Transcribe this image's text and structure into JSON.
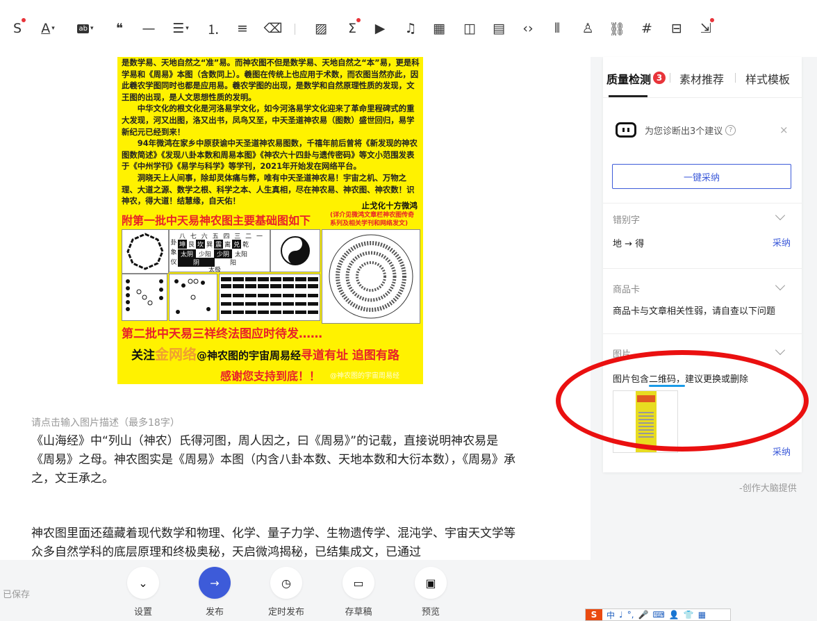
{
  "toolbar": {
    "icons": [
      "strikethrough-icon",
      "font-color-icon",
      "highlight-icon",
      "quote-icon",
      "divider-icon",
      "align-icon",
      "ordered-list-icon",
      "unordered-list-icon",
      "eraser-icon",
      "image-icon",
      "formula-icon",
      "video-icon",
      "audio-icon",
      "table-icon",
      "vote-icon",
      "save-icon",
      "code-icon",
      "chart-icon",
      "person-icon",
      "link-icon",
      "hashtag-icon",
      "bookmark-icon",
      "import-icon"
    ]
  },
  "poster": {
    "text": "是数学易、天地自然之“准”易。而神农图不但是数学易、天地自然之“本”易，更是科学易和《周易》本图（含数同上）。羲图在传统上也应用于术数，而农图当然亦此，因此羲农学图同时也都是应用易。羲农学图的出现，是数学和自然原理性质的发现，文王图的出现，是人文思想性质的发明。\n　　中华文化的根文化是河洛易学文化，如今河洛易学文化迎来了革命里程碑式的重大发现，河又出图，洛又出书，凤鸟又至，中天圣道神农易（图数）盛世回归，易学新纪元已经到来！\n　　94年微鸿在家乡中原获谕中天圣道神农易图数，千禧年前后曾将《新发现的神农图数简述》《发现八卦本数和周易本图》《神农六十四卦与遗传密码》等文小范围发表于《中州学刊》《易学与科学》等学刊，2021年开始发在网络平台。\n　　洞晓天上人间事，除却灵体痛与弊，唯有中天圣道神农易！宇宙之机、万物之理、大道之源、数学之根、科学之本、人生真相，尽在神农易、神农图、神农数！识神农，得大道！结慧缘，自天佑！",
    "signature": "止戈化十方微鸿",
    "heading1": "附第一批中天易神农图主要基础图如下",
    "heading1_note": "(详介见微鸿文章栏神农图传奇系列及相关学刊和网络发文)",
    "heading2": "第二批中天易三祥终法图应时待发……",
    "follow_prefix": "关注",
    "follow_gold": "金网络",
    "follow_middle": "@神农图的宇宙周易经",
    "follow_red": "寻道有址  追图有路",
    "thanks": "感谢您支持到底！！",
    "watermark": "@神农图的宇宙周易经",
    "bagua_top": "八 七 六 五 四 三 二 一",
    "bagua_row": [
      "坤",
      "艮",
      "坎",
      "巽",
      "震",
      "离",
      "兑",
      "乾"
    ],
    "yinyang": [
      "太阴",
      "少阳",
      "少阴",
      "太阳"
    ],
    "liangyi": [
      "阴",
      "阳"
    ],
    "taiji": "太极",
    "side_labels": [
      "卦",
      "象",
      "仪"
    ]
  },
  "editor": {
    "caption_placeholder": "请点击输入图片描述（最多18字）",
    "para1": "《山海经》中“列山（神农）氏得河图，周人因之，曰《周易》”的记载，直接说明神农易是《周易》之母。神农图实是《周易》本图（内含八卦本数、天地本数和大衍本数），《周易》承之，文王承之。",
    "para2": "神农图里面还蕴藏着现代数学和物理、化学、量子力学、生物遗传学、混沌学、宇宙天文学等众多自然学科的底层原理和终极奥秘，天启微鸿揭秘，已结集成文，已通过"
  },
  "bottom": {
    "saved": "已保存",
    "buttons": [
      {
        "label": "设置",
        "icon": "chevron-down-icon",
        "glyph": "⌄"
      },
      {
        "label": "发布",
        "icon": "arrow-right-icon",
        "glyph": "→"
      },
      {
        "label": "定时发布",
        "icon": "clock-icon",
        "glyph": "◷"
      },
      {
        "label": "存草稿",
        "icon": "draft-icon",
        "glyph": "▭"
      },
      {
        "label": "预览",
        "icon": "preview-icon",
        "glyph": "▣"
      }
    ]
  },
  "panel": {
    "tabs": [
      "质量检测",
      "素材推荐",
      "样式模板"
    ],
    "badge": "3",
    "diagnosis": "为您诊断出3个建议",
    "help": "?",
    "close": "×",
    "adopt_all": "一键采纳",
    "typo_title": "错别字",
    "typo_from": "地",
    "typo_arrow": "→",
    "typo_to": "得",
    "adopt": "采纳",
    "product_title": "商品卡",
    "product_body": "商品卡与文章相关性弱，请自查以下问题",
    "image_title": "图片",
    "image_body": "图片包含二维码，建议更换或删除",
    "source": "-创作大脑提供"
  },
  "ime": {
    "logo": "S",
    "items": [
      "中",
      "♩",
      "°,",
      "🎤",
      "⌨",
      "👤",
      "👕",
      "▦"
    ]
  },
  "colors": {
    "accent": "#3d5bd9",
    "badge": "#e8343a",
    "annotation": "#ea1010",
    "poster_bg": "#fff200",
    "poster_red": "#e8212a"
  }
}
